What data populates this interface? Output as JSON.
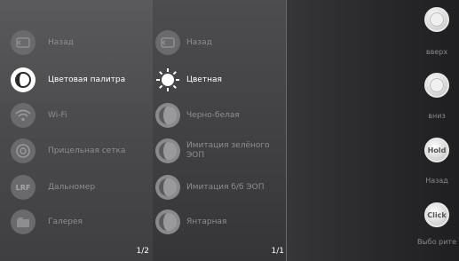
{
  "main_menu": {
    "items": [
      {
        "label": "Назад",
        "icon": "back-icon",
        "active": false
      },
      {
        "label": "Цветовая палитра",
        "icon": "palette-icon",
        "active": true
      },
      {
        "label": "Wi-Fi",
        "icon": "wifi-icon",
        "active": false
      },
      {
        "label": "Прицельная сетка",
        "icon": "reticle-icon",
        "active": false
      },
      {
        "label": "Дальномер",
        "icon": "lrf-icon",
        "active": false
      },
      {
        "label": "Галерея",
        "icon": "gallery-icon",
        "active": false
      }
    ],
    "lrf_glyph": "LRF",
    "pager": "1/2"
  },
  "palette_menu": {
    "items": [
      {
        "label": "Назад",
        "icon": "back-icon",
        "active": false
      },
      {
        "label": "Цветная",
        "icon": "sun-icon",
        "active": true
      },
      {
        "label": "Черно-белая",
        "icon": "palette-option-icon",
        "active": false
      },
      {
        "label": "Имитация зелёного ЭОП",
        "icon": "palette-option-icon",
        "active": false
      },
      {
        "label": "Имитация б/б ЭОП",
        "icon": "palette-option-icon",
        "active": false
      },
      {
        "label": "Янтарная",
        "icon": "palette-option-icon",
        "active": false
      }
    ],
    "pager": "1/1"
  },
  "hardware_buttons": {
    "up": {
      "label": "вверх"
    },
    "down": {
      "label": "вниз"
    },
    "hold": {
      "glyph": "Hold",
      "label": "Назад"
    },
    "click": {
      "glyph": "Click",
      "label": "Выбо рите"
    }
  },
  "colors": {
    "active_text": "#ffffff",
    "inactive_text": "#8e8e90"
  }
}
